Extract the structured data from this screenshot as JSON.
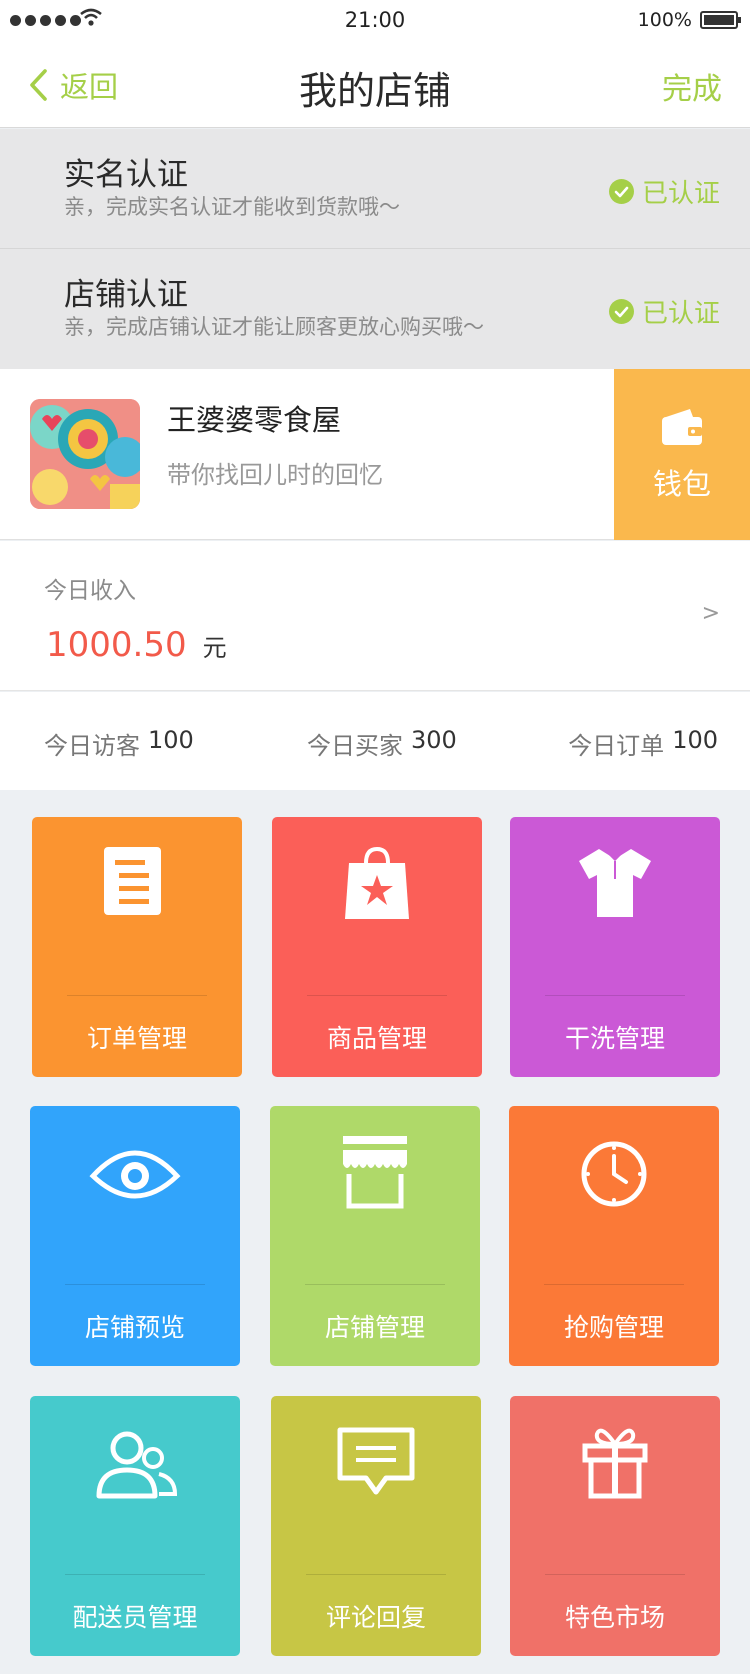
{
  "status_bar": {
    "time": "21:00",
    "battery": "100%",
    "signal_icon": "signal-dots-icon",
    "wifi_icon": "wifi-icon",
    "battery_icon": "battery-icon"
  },
  "nav": {
    "back_label": "返回",
    "title": "我的店铺",
    "done_label": "完成",
    "accent_color": "#a5cf48"
  },
  "certifications": [
    {
      "title": "实名认证",
      "desc": "亲，完成实名认证才能收到货款哦～",
      "status": "已认证"
    },
    {
      "title": "店铺认证",
      "desc": "亲，完成店铺认证才能让顾客更放心购买哦～",
      "status": "已认证"
    }
  ],
  "shop": {
    "name": "王婆婆零食屋",
    "slogan": "带你找回儿时的回忆",
    "wallet_label": "钱包",
    "wallet_color": "#fab84d"
  },
  "income": {
    "label": "今日收入",
    "amount": "1000.50",
    "unit": "元",
    "chevron": ">"
  },
  "stats": [
    {
      "label": "今日访客",
      "value": "100"
    },
    {
      "label": "今日买家",
      "value": "300"
    },
    {
      "label": "今日订单",
      "value": "100"
    }
  ],
  "tiles": [
    {
      "label": "订单管理",
      "icon": "order-list-icon",
      "color": "#fb9430"
    },
    {
      "label": "商品管理",
      "icon": "shopping-bag-icon",
      "color": "#fb5f58"
    },
    {
      "label": "干洗管理",
      "icon": "shirt-icon",
      "color": "#cb59d6"
    },
    {
      "label": "店铺预览",
      "icon": "eye-icon",
      "color": "#31a4fb"
    },
    {
      "label": "店铺管理",
      "icon": "storefront-icon",
      "color": "#afd969"
    },
    {
      "label": "抢购管理",
      "icon": "clock-icon",
      "color": "#fb7937"
    },
    {
      "label": "配送员管理",
      "icon": "users-icon",
      "color": "#46cacc"
    },
    {
      "label": "评论回复",
      "icon": "comment-icon",
      "color": "#c7c645"
    },
    {
      "label": "特色市场",
      "icon": "gift-icon",
      "color": "#f07168"
    }
  ]
}
